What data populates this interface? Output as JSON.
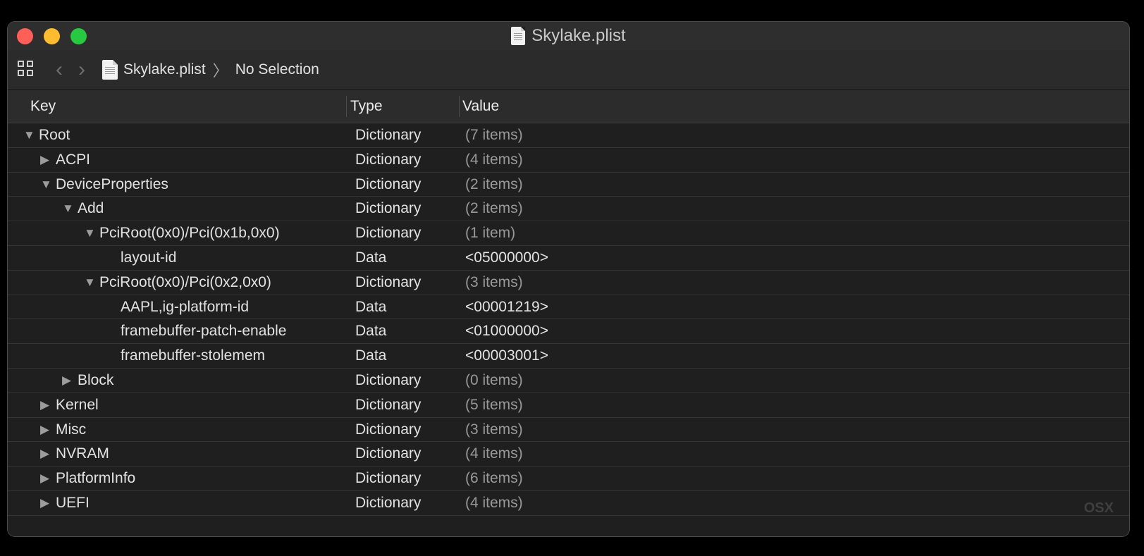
{
  "window": {
    "title": "Skylake.plist"
  },
  "toolbar": {
    "back_icon": "‹",
    "forward_icon": "›",
    "breadcrumb_file": "Skylake.plist",
    "breadcrumb_separator": "〉",
    "breadcrumb_selection": "No Selection"
  },
  "table": {
    "headers": {
      "key": "Key",
      "type": "Type",
      "value": "Value"
    },
    "rows": [
      {
        "key": "Root",
        "type": "Dictionary",
        "value": "(7 items)",
        "disclosure": "▼",
        "muted": true
      },
      {
        "key": "ACPI",
        "type": "Dictionary",
        "value": "(4 items)",
        "disclosure": "▶",
        "muted": true
      },
      {
        "key": "DeviceProperties",
        "type": "Dictionary",
        "value": "(2 items)",
        "disclosure": "▼",
        "muted": true
      },
      {
        "key": "Add",
        "type": "Dictionary",
        "value": "(2 items)",
        "disclosure": "▼",
        "muted": true
      },
      {
        "key": "PciRoot(0x0)/Pci(0x1b,0x0)",
        "type": "Dictionary",
        "value": "(1 item)",
        "disclosure": "▼",
        "muted": true
      },
      {
        "key": "layout-id",
        "type": "Data",
        "value": "<05000000>",
        "disclosure": "",
        "muted": false
      },
      {
        "key": "PciRoot(0x0)/Pci(0x2,0x0)",
        "type": "Dictionary",
        "value": "(3 items)",
        "disclosure": "▼",
        "muted": true
      },
      {
        "key": "AAPL,ig-platform-id",
        "type": "Data",
        "value": "<00001219>",
        "disclosure": "",
        "muted": false
      },
      {
        "key": "framebuffer-patch-enable",
        "type": "Data",
        "value": "<01000000>",
        "disclosure": "",
        "muted": false
      },
      {
        "key": "framebuffer-stolemem",
        "type": "Data",
        "value": "<00003001>",
        "disclosure": "",
        "muted": false
      },
      {
        "key": "Block",
        "type": "Dictionary",
        "value": "(0 items)",
        "disclosure": "▶",
        "muted": true
      },
      {
        "key": "Kernel",
        "type": "Dictionary",
        "value": "(5 items)",
        "disclosure": "▶",
        "muted": true
      },
      {
        "key": "Misc",
        "type": "Dictionary",
        "value": "(3 items)",
        "disclosure": "▶",
        "muted": true
      },
      {
        "key": "NVRAM",
        "type": "Dictionary",
        "value": "(4 items)",
        "disclosure": "▶",
        "muted": true
      },
      {
        "key": "PlatformInfo",
        "type": "Dictionary",
        "value": "(6 items)",
        "disclosure": "▶",
        "muted": true
      },
      {
        "key": "UEFI",
        "type": "Dictionary",
        "value": "(4 items)",
        "disclosure": "▶",
        "muted": true
      }
    ]
  },
  "watermark": "OSX"
}
